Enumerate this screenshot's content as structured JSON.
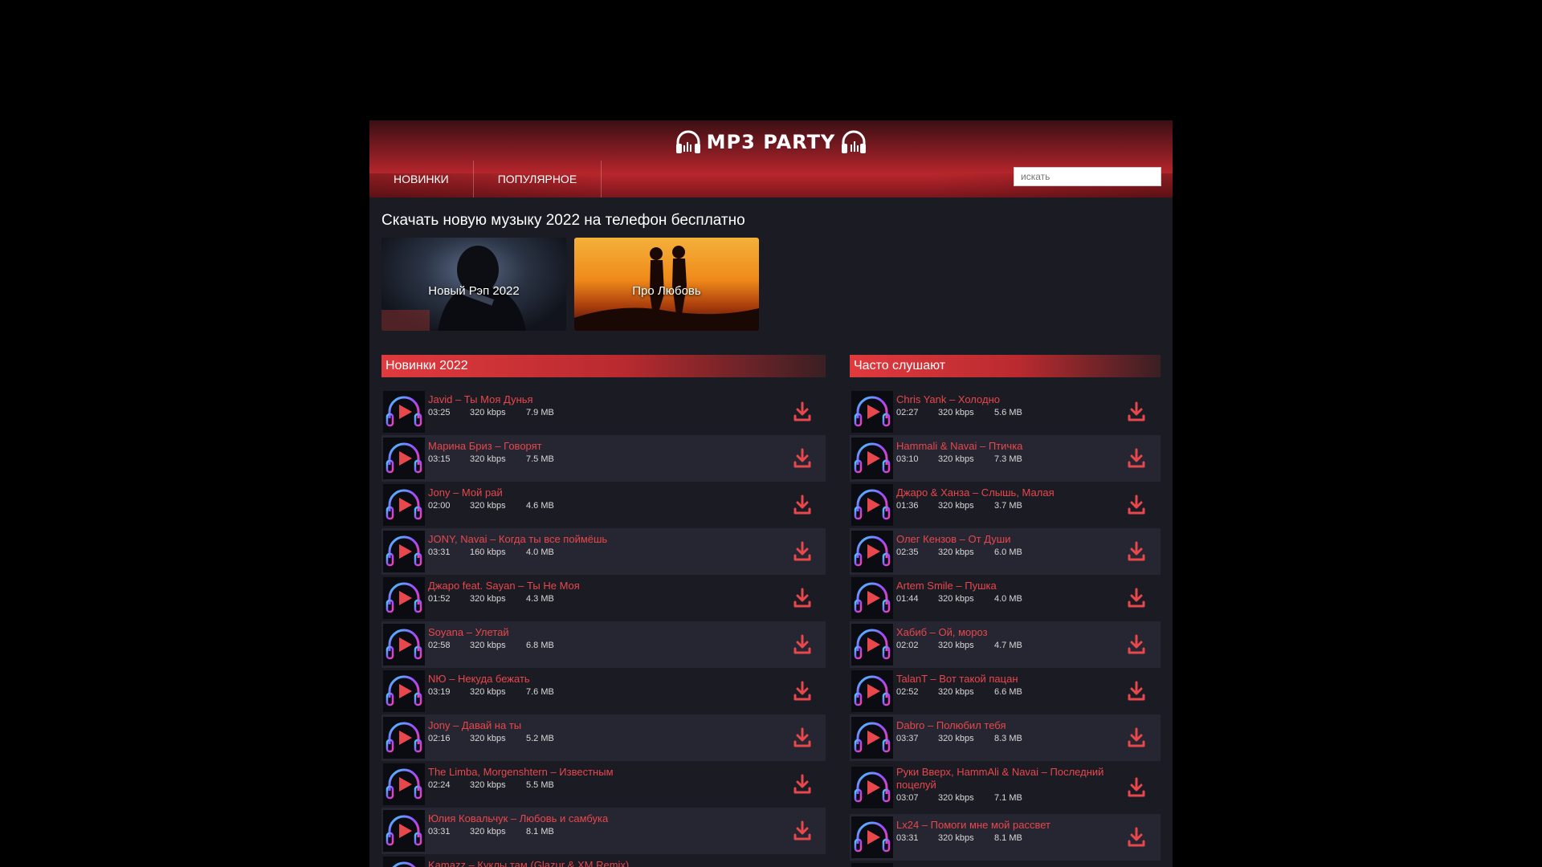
{
  "site": {
    "logo_text": "MP3 PARTY",
    "nav": [
      "НОВИНКИ",
      "ПОПУЛЯРНОЕ"
    ],
    "search_placeholder": "искать",
    "page_title": "Скачать новую музыку 2022 на телефон бесплатно",
    "categories": [
      "Новый Рэп 2022",
      "Про Любовь"
    ]
  },
  "colors": {
    "accent": "#e8474b",
    "header": "#b8262c",
    "bg": "#1b1b24",
    "row_alt": "#262632"
  },
  "icons": {
    "play": "play-headphones-icon",
    "download": "download-icon",
    "logo": "headphones-icon"
  },
  "new_section": {
    "title": "Новинки 2022",
    "tracks": [
      {
        "title": "Javid – Ты Моя Дунья",
        "duration": "03:25",
        "bitrate": "320 kbps",
        "size": "7.9 MB"
      },
      {
        "title": "Марина Бриз – Говорят",
        "duration": "03:15",
        "bitrate": "320 kbps",
        "size": "7.5 MB"
      },
      {
        "title": "Jony – Мой рай",
        "duration": "02:00",
        "bitrate": "320 kbps",
        "size": "4.6 MB"
      },
      {
        "title": "JONY, Navai – Когда ты все поймёшь",
        "duration": "03:31",
        "bitrate": "160 kbps",
        "size": "4.0 MB"
      },
      {
        "title": "Джаро feat. Sayan – Ты Не Моя",
        "duration": "01:52",
        "bitrate": "320 kbps",
        "size": "4.3 MB"
      },
      {
        "title": "Soyana – Улетай",
        "duration": "02:58",
        "bitrate": "320 kbps",
        "size": "6.8 MB"
      },
      {
        "title": "NЮ – Некуда бежать",
        "duration": "03:19",
        "bitrate": "320 kbps",
        "size": "7.6 MB"
      },
      {
        "title": "Jony – Давай на ты",
        "duration": "02:16",
        "bitrate": "320 kbps",
        "size": "5.2 MB"
      },
      {
        "title": "The Limba, Morgenshtern – Известным",
        "duration": "02:24",
        "bitrate": "320 kbps",
        "size": "5.5 MB"
      },
      {
        "title": "Юлия Ковальчук – Любовь и самбука",
        "duration": "03:31",
        "bitrate": "320 kbps",
        "size": "8.1 MB"
      },
      {
        "title": "Kamazz – Куклы там (Glazur & XM Remix)",
        "duration": "",
        "bitrate": "",
        "size": ""
      }
    ]
  },
  "popular_section": {
    "title": "Часто слушают",
    "tracks": [
      {
        "title": "Chris Yank – Холодно",
        "duration": "02:27",
        "bitrate": "320 kbps",
        "size": "5.6 MB"
      },
      {
        "title": "Hammali & Navai – Птичка",
        "duration": "03:10",
        "bitrate": "320 kbps",
        "size": "7.3 MB"
      },
      {
        "title": "Джаро & Ханза – Слышь, Малая",
        "duration": "01:36",
        "bitrate": "320 kbps",
        "size": "3.7 MB"
      },
      {
        "title": "Олег Кензов – От Души",
        "duration": "02:35",
        "bitrate": "320 kbps",
        "size": "6.0 MB"
      },
      {
        "title": "Artem Smile – Пушка",
        "duration": "01:44",
        "bitrate": "320 kbps",
        "size": "4.0 MB"
      },
      {
        "title": "Хабиб – Ой, мороз",
        "duration": "02:02",
        "bitrate": "320 kbps",
        "size": "4.7 MB"
      },
      {
        "title": "TalanT – Вот такой пацан",
        "duration": "02:52",
        "bitrate": "320 kbps",
        "size": "6.6 MB"
      },
      {
        "title": "Dabro – Полюбил тебя",
        "duration": "03:37",
        "bitrate": "320 kbps",
        "size": "8.3 MB"
      },
      {
        "title": "Руки Вверх, HammAli & Navai – Последний поцелуй",
        "duration": "03:07",
        "bitrate": "320 kbps",
        "size": "7.1 MB"
      },
      {
        "title": "Lx24 – Помоги мне мой рассвет",
        "duration": "03:31",
        "bitrate": "320 kbps",
        "size": "8.1 MB"
      },
      {
        "title": "",
        "duration": "",
        "bitrate": "",
        "size": ""
      }
    ]
  }
}
